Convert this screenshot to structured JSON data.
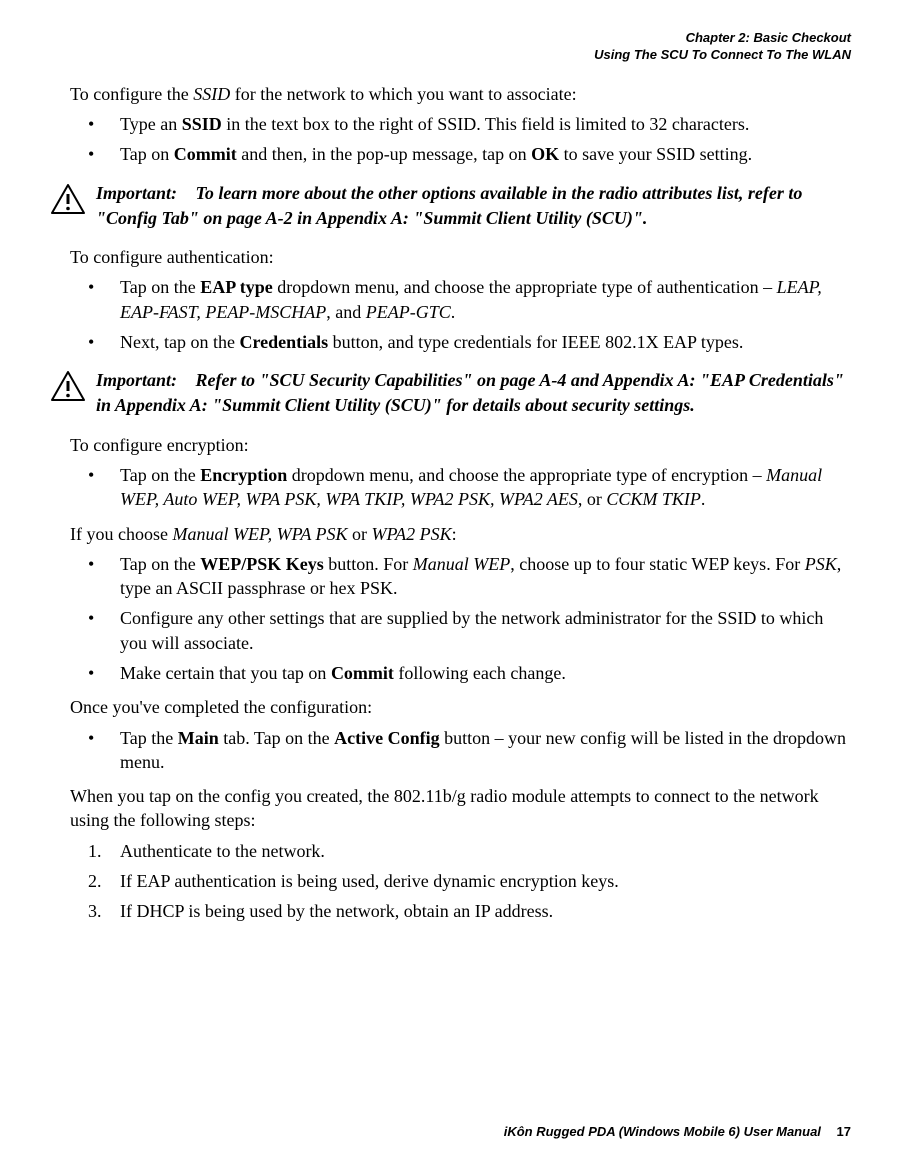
{
  "header": {
    "chapter": "Chapter 2: Basic Checkout",
    "section": "Using The SCU To Connect To The WLAN"
  },
  "content": {
    "p1_pre": "To configure the ",
    "p1_i": "SSID",
    "p1_post": " for the network to which you want to associate:",
    "b1_li1_pre": "Type an ",
    "b1_li1_b": "SSID",
    "b1_li1_post": " in the text box to the right of SSID. This field is limited to 32 characters.",
    "b1_li2_pre": "Tap on ",
    "b1_li2_b1": "Commit",
    "b1_li2_mid": " and then, in the pop-up message, tap on ",
    "b1_li2_b2": "OK",
    "b1_li2_post": " to save your SSID setting.",
    "imp1_label": "Important:",
    "imp1_text": "To learn more about the other options available in the radio attributes list, refer to \"Config Tab\" on page A-2 in Appendix A: \"Summit Client Utility (SCU)\".",
    "p2": "To configure authentication:",
    "b2_li1_pre": "Tap on the ",
    "b2_li1_b": "EAP type",
    "b2_li1_mid": " dropdown menu, and choose the appropriate type of authentication – ",
    "b2_li1_i": "LEAP, EAP-FAST, PEAP-MSCHAP",
    "b2_li1_mid2": ", and ",
    "b2_li1_i2": "PEAP-GTC",
    "b2_li1_post": ".",
    "b2_li2_pre": "Next, tap on the ",
    "b2_li2_b": "Credentials",
    "b2_li2_post": " button, and type credentials for IEEE 802.1X EAP types.",
    "imp2_label": "Important:",
    "imp2_text": "Refer to \"SCU Security Capabilities\" on page A-4 and Appendix A: \"EAP Credentials\" in Appendix A: \"Summit Client Utility (SCU)\" for details about security settings.",
    "p3": "To configure encryption:",
    "b3_li1_pre": "Tap on the ",
    "b3_li1_b": "Encryption",
    "b3_li1_mid": " dropdown menu, and choose the appropriate type of encryption – ",
    "b3_li1_i": "Manual WEP, Auto WEP, WPA PSK, WPA TKIP, WPA2 PSK, WPA2 AES",
    "b3_li1_mid2": ", or ",
    "b3_li1_i2": "CCKM TKIP",
    "b3_li1_post": ".",
    "p4_pre": "If you choose ",
    "p4_i": "Manual WEP, WPA PSK",
    "p4_mid": " or ",
    "p4_i2": "WPA2 PSK",
    "p4_post": ":",
    "b4_li1_pre": "Tap on the ",
    "b4_li1_b": "WEP/PSK Keys",
    "b4_li1_mid": " button. For ",
    "b4_li1_i": "Manual WEP",
    "b4_li1_mid2": ", choose up to four static WEP keys. For ",
    "b4_li1_i2": "PSK",
    "b4_li1_post": ", type an ASCII passphrase or hex PSK.",
    "b4_li2": "Configure any other settings that are supplied by the network administrator for the SSID to which you will associate.",
    "b4_li3_pre": "Make certain that you tap on ",
    "b4_li3_b": "Commit",
    "b4_li3_post": " following each change.",
    "p5": "Once you've completed the configuration:",
    "b5_li1_pre": "Tap the ",
    "b5_li1_b1": "Main",
    "b5_li1_mid": " tab. Tap on the ",
    "b5_li1_b2": "Active Config",
    "b5_li1_post": " button – your new config will be listed in the dropdown menu.",
    "p6": "When you tap on the config you created, the 802.11b/g radio module attempts to connect to the network using the following steps:",
    "n1": "Authenticate to the network.",
    "n2": "If EAP authentication is being used, derive dynamic encryption keys.",
    "n3": "If DHCP is being used by the network, obtain an IP address."
  },
  "footer": {
    "manual": "iKôn Rugged PDA (Windows Mobile 6) User Manual",
    "page": "17"
  }
}
